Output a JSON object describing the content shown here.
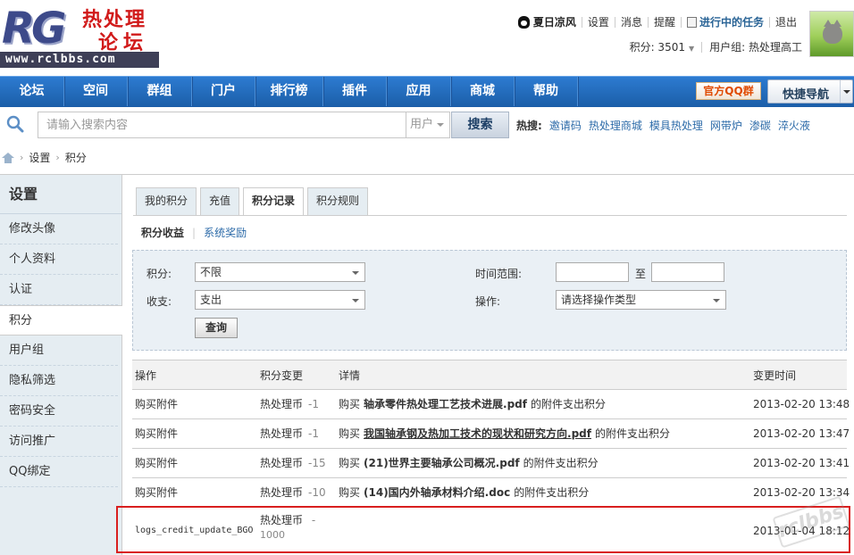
{
  "logo": {
    "brand": "RG",
    "cn_line1": "热处理",
    "cn_line2": "论坛",
    "url": "www.rclbbs.com"
  },
  "user_nav": {
    "username": "夏日凉风",
    "settings": "设置",
    "messages": "消息",
    "reminders": "提醒",
    "tasks": "进行中的任务",
    "logout": "退出"
  },
  "user_info": {
    "points_label": "积分: 3501",
    "group_label": "用户组: 热处理高工"
  },
  "nav": {
    "items": [
      "论坛",
      "空间",
      "群组",
      "门户",
      "排行榜",
      "插件",
      "应用",
      "商城",
      "帮助"
    ],
    "qq_group": "官方QQ群",
    "quick_nav": "快捷导航"
  },
  "search": {
    "placeholder": "请输入搜索内容",
    "type": "用户",
    "button": "搜索",
    "hot_label": "热搜:",
    "hot_links": [
      "邀请码",
      "热处理商城",
      "模具热处理",
      "网带炉",
      "渗碳",
      "淬火液"
    ]
  },
  "breadcrumb": {
    "items": [
      "设置",
      "积分"
    ]
  },
  "sidebar": {
    "title": "设置",
    "items": [
      "修改头像",
      "个人资料",
      "认证",
      "积分",
      "用户组",
      "隐私筛选",
      "密码安全",
      "访问推广",
      "QQ绑定"
    ],
    "active_index": 3
  },
  "tabs": {
    "items": [
      "我的积分",
      "充值",
      "积分记录",
      "积分规则"
    ],
    "active_index": 2
  },
  "subtabs": {
    "active": "积分收益",
    "other": "系统奖励"
  },
  "filter": {
    "points_label": "积分:",
    "points_value": "不限",
    "income_label": "收支:",
    "income_value": "支出",
    "time_label": "时间范围:",
    "to_label": "至",
    "op_label": "操作:",
    "op_value": "请选择操作类型",
    "query_button": "查询"
  },
  "table": {
    "headers": {
      "op": "操作",
      "change": "积分变更",
      "detail": "详情",
      "time": "变更时间"
    },
    "rows": [
      {
        "op": "购买附件",
        "currency": "热处理币",
        "delta": "-1",
        "detail_prefix": "购买",
        "file": "轴承零件热处理工艺技术进展.pdf",
        "detail_suffix": "的附件支出积分",
        "time": "2013-02-20 13:48"
      },
      {
        "op": "购买附件",
        "currency": "热处理币",
        "delta": "-1",
        "detail_prefix": "购买",
        "file": "我国轴承钢及热加工技术的现状和研究方向.pdf",
        "detail_suffix": "的附件支出积分",
        "time": "2013-02-20 13:47"
      },
      {
        "op": "购买附件",
        "currency": "热处理币",
        "delta": "-15",
        "detail_prefix": "购买",
        "file": "(21)世界主要轴承公司概况.pdf",
        "detail_suffix": "的附件支出积分",
        "time": "2013-02-20 13:41"
      },
      {
        "op": "购买附件",
        "currency": "热处理币",
        "delta": "-10",
        "detail_prefix": "购买",
        "file": "(14)国内外轴承材料介绍.doc",
        "detail_suffix": "的附件支出积分",
        "time": "2013-02-20 13:34"
      },
      {
        "op": "logs_credit_update_BGO",
        "currency": "热处理币",
        "delta": "-",
        "amount": "1000",
        "time": "2013-01-04 18:12"
      }
    ]
  },
  "watermark": "rclbbs"
}
